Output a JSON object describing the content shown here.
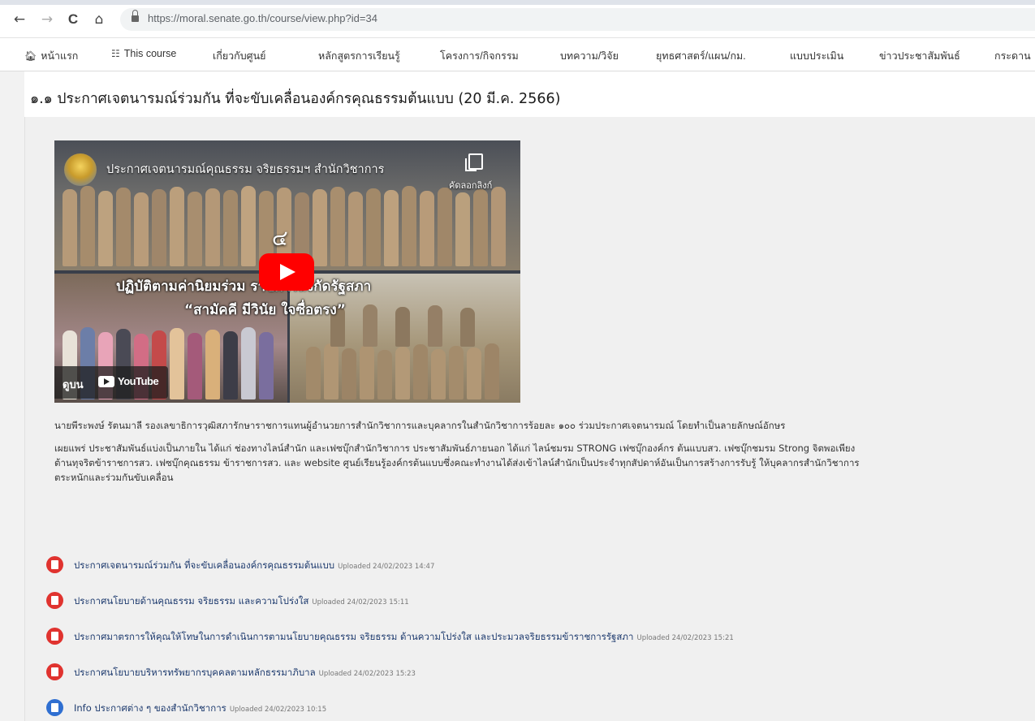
{
  "browser": {
    "back_icon": "←",
    "forward_icon": "→",
    "reload_icon": "C",
    "home_icon": "⌂",
    "url": "https://moral.senate.go.th/course/view.php?id=34"
  },
  "nav": {
    "items": [
      {
        "icon": "home-icon",
        "label": "หน้าแรก"
      },
      {
        "icon": "sitemap-icon",
        "label": "This course"
      },
      {
        "label": "เกี่ยวกับศูนย์"
      },
      {
        "label": "หลักสูตรการเรียนรู้"
      },
      {
        "label": "โครงการ/กิจกรรม"
      },
      {
        "label": "บทความ/วิจัย"
      },
      {
        "label": "ยุทธศาสตร์/แผน/กม."
      },
      {
        "label": "แบบประเมิน"
      },
      {
        "label": "ข่าวประชาสัมพันธ์"
      },
      {
        "label": "กระดาน"
      }
    ]
  },
  "page_title": "๑.๑ ประกาศเจตนารมณ์ร่วมกัน ที่จะขับเคลื่อนองค์กรคุณธรรมต้นแบบ (20 มี.ค. 2566)",
  "video": {
    "channel_title": "ประกาศเจตนารมณ์คุณธรรม จริยธรรมฯ สำนักวิชาการ",
    "copy_link": "คัดลอกลิงก์",
    "number_overlay": "๔",
    "overlay_line1": "ปฏิบัติตามค่านิยมร่วม      ราชการสังกัดรัฐสภา",
    "overlay_line2": "“สามัคคี มีวินัย ใจซื่อตรง”",
    "watch_on": "ดูบน",
    "youtube": "YouTube"
  },
  "paragraph1": "นายพีระพงษ์ รัตนมาลี รองเลขาธิการวุฒิสภารักษาราชการแทนผู้อำนวยการสำนักวิชาการและบุคลากรในสำนักวิชาการร้อยละ ๑๐๐ ร่วมประกาศเจตนารมณ์ โดยทำเป็นลายลักษณ์อักษร",
  "paragraph2_line1": "เผยแพร่ ประชาสัมพันธ์แบ่งเป็นภายใน ได้แก่ ช่องทางไลน์สำนัก และเฟซบุ๊กสำนักวิชาการ  ประชาสัมพันธ์ภายนอก ได้แก่ ไลน์ชมรม STRONG เฟซบุ๊กองค์กร ต้นแบบสว. เฟซบุ๊กชมรม Strong จิตพอเพียง",
  "paragraph2_line2": "ต้านทุจริตข้าราชการสว. เฟซบุ๊กคุณธรรม ข้าราชการสว. และ website ศูนย์เรียนรู้องค์กรต้นแบบซึ่งคณะทำงานได้ส่งเข้าไลน์สำนักเป็นประจำทุกสัปดาห์อันเป็นการสร้างการรับรู้ ให้บุคลากรสำนักวิชาการ",
  "paragraph2_line3": "ตระหนักและร่วมกันขับเคลื่อน",
  "attachments": [
    {
      "type": "pdf",
      "icon": "pdf-icon",
      "name": "ประกาศเจตนารมณ์ร่วมกัน ที่จะขับเคลื่อนองค์กรคุณธรรมต้นแบบ",
      "meta": "Uploaded 24/02/2023 14:47"
    },
    {
      "type": "pdf",
      "icon": "pdf-icon",
      "name": "ประกาศนโยบายด้านคุณธรรม จริยธรรม และความโปร่งใส",
      "meta": "Uploaded 24/02/2023 15:11"
    },
    {
      "type": "pdf",
      "icon": "pdf-icon",
      "name": "ประกาศมาตรการให้คุณให้โทษในการดำเนินการตามนโยบายคุณธรรม จริยธรรม ด้านความโปร่งใส และประมวลจริยธรรมข้าราชการรัฐสภา",
      "meta": "Uploaded 24/02/2023 15:21"
    },
    {
      "type": "pdf",
      "icon": "pdf-icon",
      "name": "ประกาศนโยบายบริหารทรัพยากรบุคคลตามหลักธรรมาภิบาล",
      "meta": "Uploaded 24/02/2023 15:23"
    },
    {
      "type": "doc",
      "icon": "document-icon",
      "name": "Info ประกาศต่าง ๆ ของสำนักวิชาการ",
      "meta": "Uploaded 24/02/2023 10:15"
    }
  ],
  "colors": {
    "pdf": "#e0332f",
    "doc": "#2f6fd1",
    "youtube_red": "#ff0000"
  }
}
